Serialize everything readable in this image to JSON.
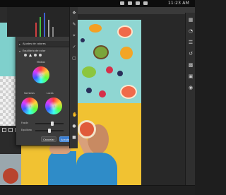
{
  "menubar": {
    "clock": "11:23 AM"
  },
  "dialog": {
    "sections": [
      {
        "label": "Ajustes de colores"
      },
      {
        "label": "Equilibrio de color"
      }
    ],
    "wheel_labels": {
      "midtones": "Medios",
      "shadows": "Sombras",
      "highlights": "Luces"
    },
    "sliders": [
      {
        "label": "Fusión",
        "value": 0.55
      },
      {
        "label": "Equilibrio",
        "value": 0.5
      }
    ],
    "buttons": {
      "cancel": "Cancelar",
      "ok": "Aceptar"
    }
  },
  "colors": {
    "accent_button": "#3b7fd4",
    "canvas_teal": "#8fd6d2",
    "canvas_yellow": "#f1c232",
    "shirt": "#2f8cc8"
  },
  "icons": [
    "move-icon",
    "brush-icon",
    "crop-icon",
    "eyedropper-icon",
    "layers-icon",
    "adjustments-icon",
    "properties-icon"
  ]
}
